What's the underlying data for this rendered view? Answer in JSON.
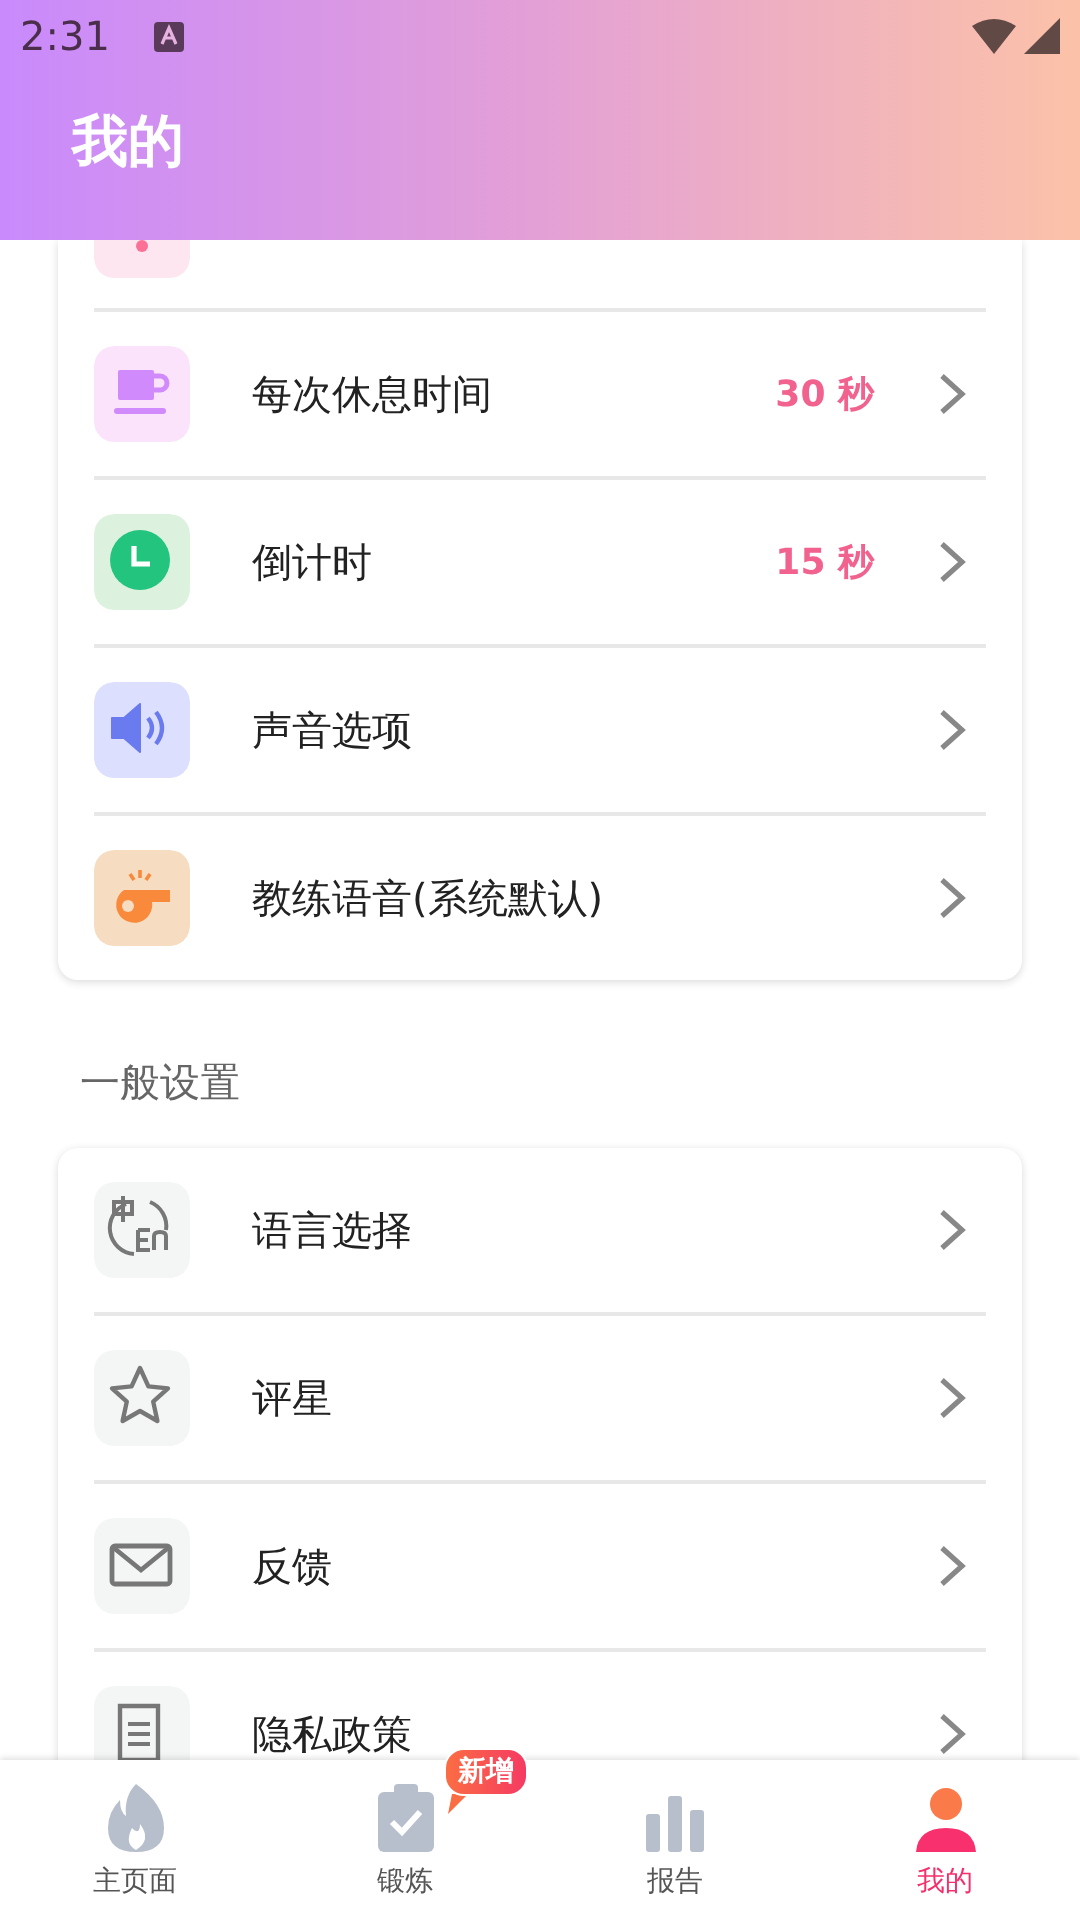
{
  "status_bar": {
    "time": "2:31"
  },
  "header": {
    "title": "我的"
  },
  "sections": [
    {
      "items": [
        {
          "label": "每次休息时间",
          "value": "30 秒"
        },
        {
          "label": "倒计时",
          "value": "15 秒"
        },
        {
          "label": "声音选项"
        },
        {
          "label": "教练语音(系统默认)"
        }
      ]
    },
    {
      "title": "一般设置",
      "items": [
        {
          "label": "语言选择"
        },
        {
          "label": "评星"
        },
        {
          "label": "反馈"
        },
        {
          "label": "隐私政策"
        }
      ]
    }
  ],
  "bottom_nav": [
    {
      "label": "主页面",
      "selected": false
    },
    {
      "label": "锻炼",
      "selected": false,
      "badge": "新增"
    },
    {
      "label": "报告",
      "selected": false
    },
    {
      "label": "我的",
      "selected": true
    }
  ]
}
